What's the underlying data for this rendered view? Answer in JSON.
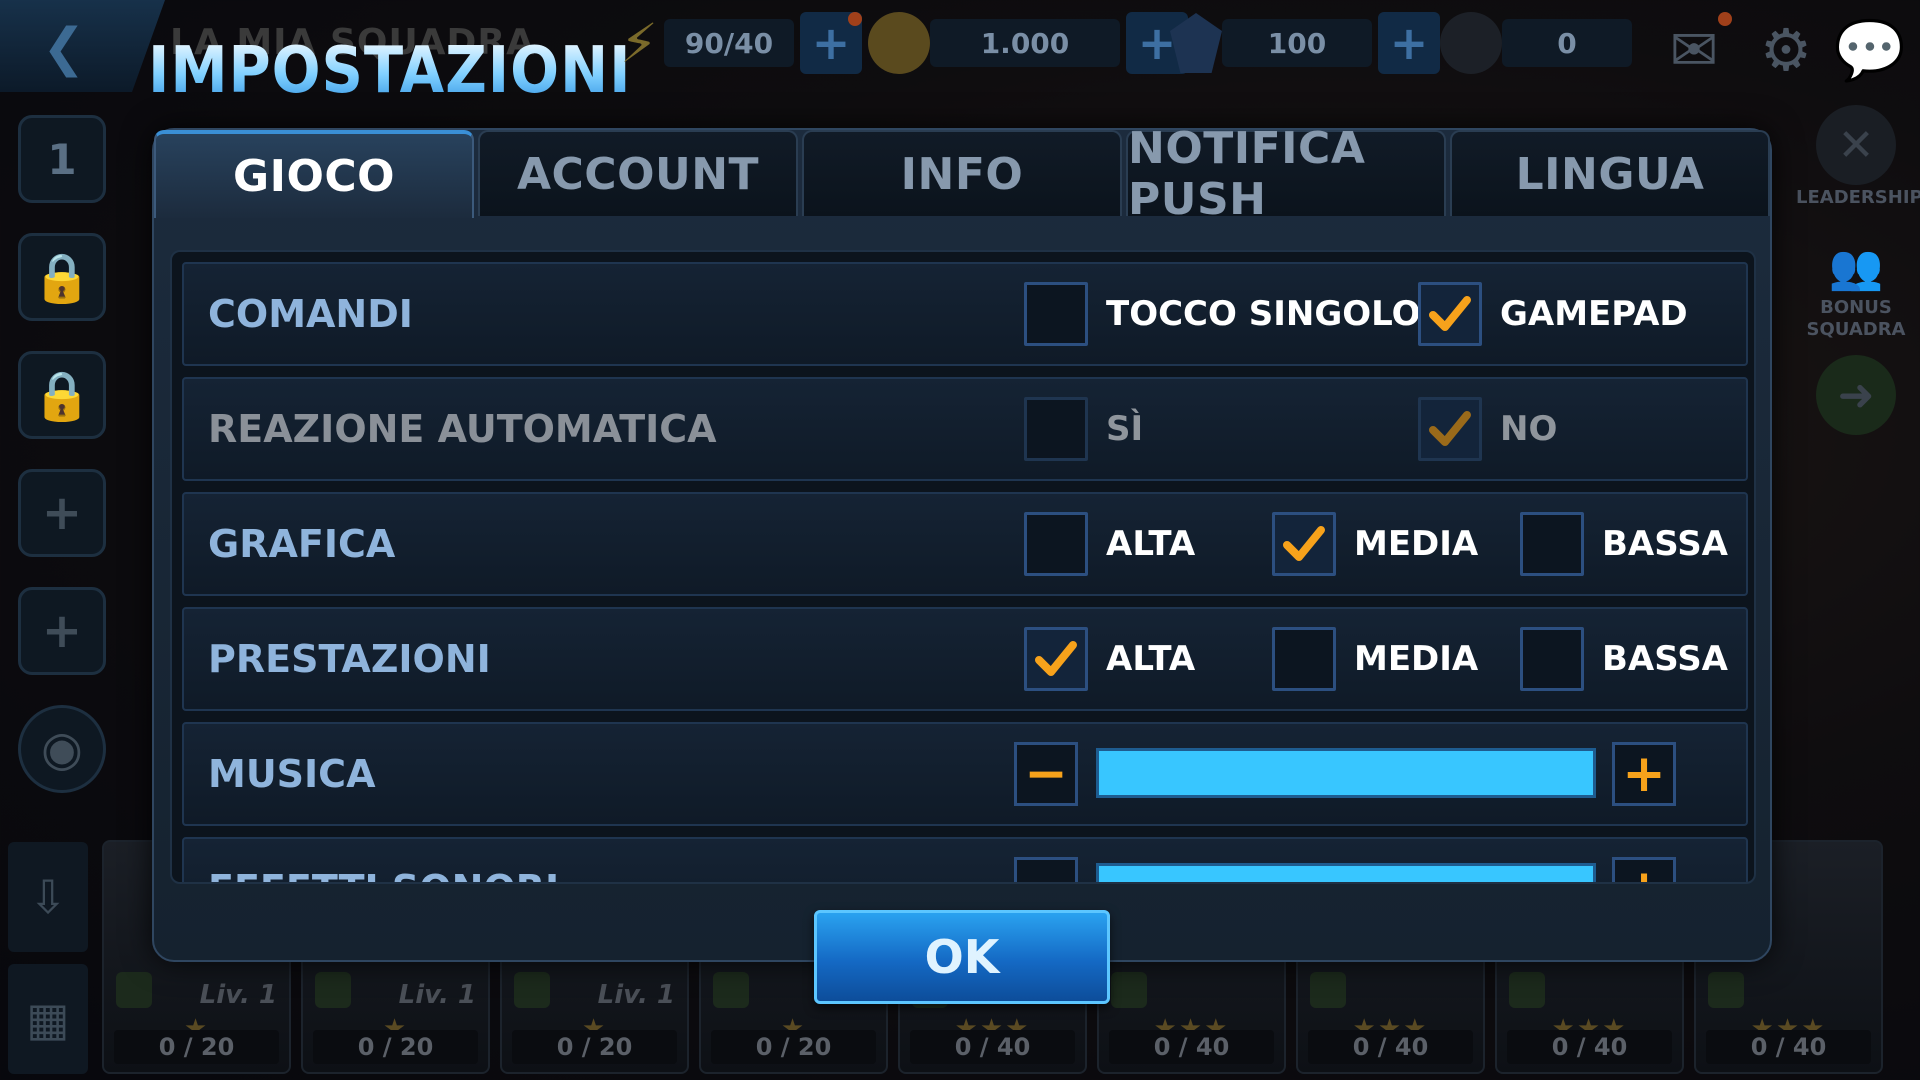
{
  "top_bar": {
    "back_icon": "chevron-left-icon",
    "background_title": "LA MIA SQUADRA",
    "title": "IMPOSTAZIONI",
    "energy": "90/40",
    "gold": "1.000",
    "crystals": "100",
    "alliance_points": "0"
  },
  "left_rail": {
    "slot_number": "1"
  },
  "right_rail": {
    "leadership": "LEADERSHIP",
    "team_bonus": "BONUS\nSQUADRA"
  },
  "tabs": [
    {
      "label": "GIOCO",
      "active": true
    },
    {
      "label": "ACCOUNT",
      "active": false
    },
    {
      "label": "INFO",
      "active": false
    },
    {
      "label": "NOTIFICA PUSH",
      "active": false
    },
    {
      "label": "LINGUA",
      "active": false
    }
  ],
  "settings": {
    "comandi": {
      "label": "COMANDI",
      "options": [
        {
          "label": "TOCCO SINGOLO",
          "checked": false
        },
        {
          "label": "GAMEPAD",
          "checked": true
        }
      ]
    },
    "reazione": {
      "label": "REAZIONE AUTOMATICA",
      "options": [
        {
          "label": "SÌ",
          "checked": false
        },
        {
          "label": "NO",
          "checked": true
        }
      ]
    },
    "grafica": {
      "label": "GRAFICA",
      "options": [
        {
          "label": "ALTA",
          "checked": false
        },
        {
          "label": "MEDIA",
          "checked": true
        },
        {
          "label": "BASSA",
          "checked": false
        }
      ]
    },
    "prestazioni": {
      "label": "PRESTAZIONI",
      "options": [
        {
          "label": "ALTA",
          "checked": true
        },
        {
          "label": "MEDIA",
          "checked": false
        },
        {
          "label": "BASSA",
          "checked": false
        }
      ]
    },
    "musica": {
      "label": "MUSICA",
      "level": 1.0
    },
    "effetti": {
      "label": "EFFETTI SONORI",
      "level": 1.0
    }
  },
  "ok_button": "OK",
  "heroes": [
    {
      "level": "Liv. 1",
      "stars": "★",
      "progress": "0 / 20"
    },
    {
      "level": "Liv. 1",
      "stars": "★",
      "progress": "0 / 20"
    },
    {
      "level": "Liv. 1",
      "stars": "★",
      "progress": "0 / 20"
    },
    {
      "level": "",
      "stars": "★",
      "progress": "0 / 20"
    },
    {
      "level": "",
      "stars": "★★★",
      "progress": "0 / 40"
    },
    {
      "level": "",
      "stars": "★★★",
      "progress": "0 / 40"
    },
    {
      "level": "",
      "stars": "★★★",
      "progress": "0 / 40"
    },
    {
      "level": "",
      "stars": "★★★",
      "progress": "0 / 40"
    },
    {
      "level": "",
      "stars": "★★★",
      "progress": "0 / 40"
    }
  ],
  "colors": {
    "accent": "#38c6ff",
    "check": "#f7a21b",
    "label": "#8fb4dc"
  }
}
